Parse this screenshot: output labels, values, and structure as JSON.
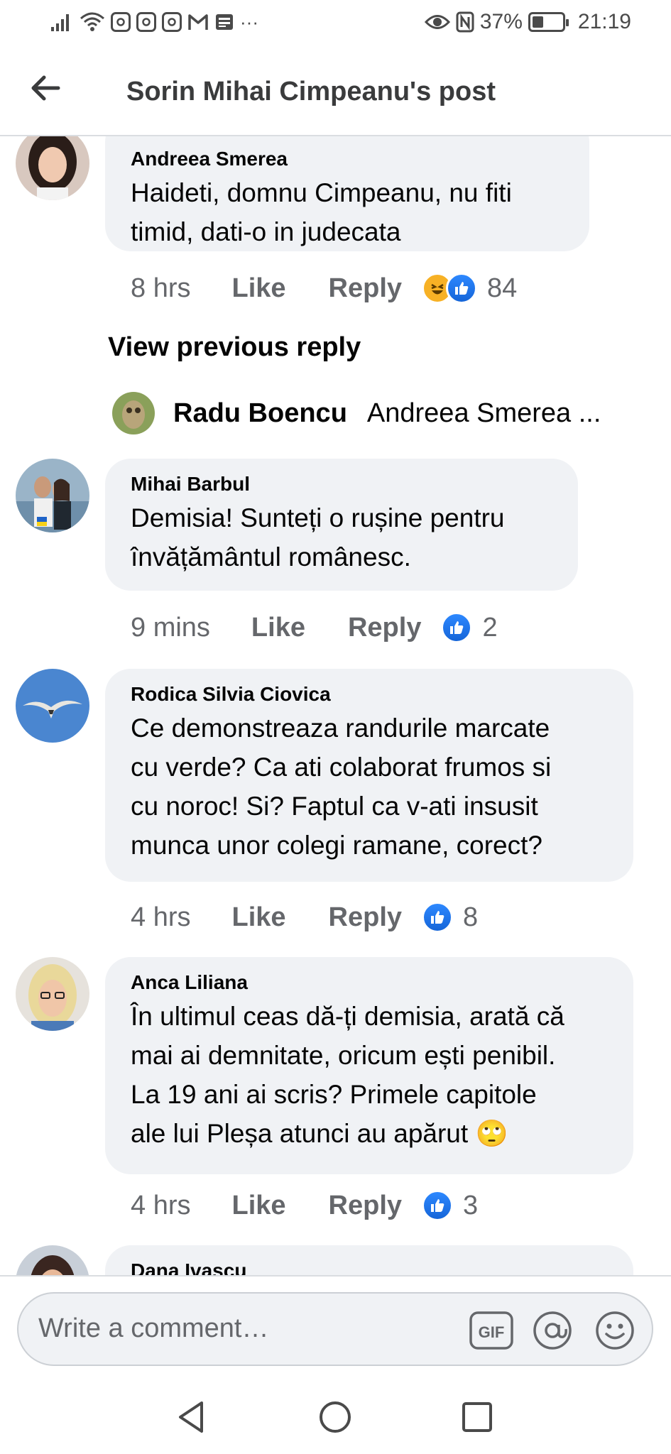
{
  "status_bar": {
    "battery": "37%",
    "battery_level": 0.37,
    "time": "21:19",
    "more": "···"
  },
  "header": {
    "title": "Sorin Mihai Cimpeanu's post"
  },
  "comments": [
    {
      "author": "Andreea Smerea",
      "lines": [
        "Haideti, domnu Cimpeanu, nu fiti",
        "timid, dati-o in judecata"
      ],
      "time": "8 hrs",
      "like": "Like",
      "reply": "Reply",
      "reactions": [
        "haha",
        "like"
      ],
      "count": "84"
    },
    {
      "author": "Mihai Barbul",
      "lines": [
        "Demisia! Sunteți o rușine pentru",
        "învățământul românesc."
      ],
      "time": "9 mins",
      "like": "Like",
      "reply": "Reply",
      "reactions": [
        "like"
      ],
      "count": "2"
    },
    {
      "author": "Rodica Silvia Ciovica",
      "lines": [
        "Ce demonstreaza randurile marcate",
        "cu verde? Ca ati colaborat frumos si",
        "cu noroc! Si? Faptul ca v-ati insusit",
        "munca unor colegi ramane, corect?"
      ],
      "time": "4 hrs",
      "like": "Like",
      "reply": "Reply",
      "reactions": [
        "like"
      ],
      "count": "8"
    },
    {
      "author": "Anca Liliana",
      "lines": [
        "În ultimul ceas dă-ți demisia, arată că",
        "mai ai demnitate, oricum ești penibil.",
        "La 19 ani ai scris? Primele capitole",
        "ale lui Pleșa atunci au apărut"
      ],
      "emoji": "🙄",
      "time": "4 hrs",
      "like": "Like",
      "reply": "Reply",
      "reactions": [
        "like"
      ],
      "count": "3"
    },
    {
      "author": "Dana Ivascu",
      "lines": []
    }
  ],
  "view_previous_reply": "View previous reply",
  "collapsed_reply": {
    "author": "Radu Boencu",
    "snippet": "Andreea Smerea ..."
  },
  "composer": {
    "placeholder": "Write a comment…",
    "gif_label": "GIF"
  },
  "colors": {
    "bubble": "#f0f2f5",
    "like_blue": "#1877f2",
    "secondary_text": "#65676b",
    "haha_yellow": "#f7b125"
  }
}
